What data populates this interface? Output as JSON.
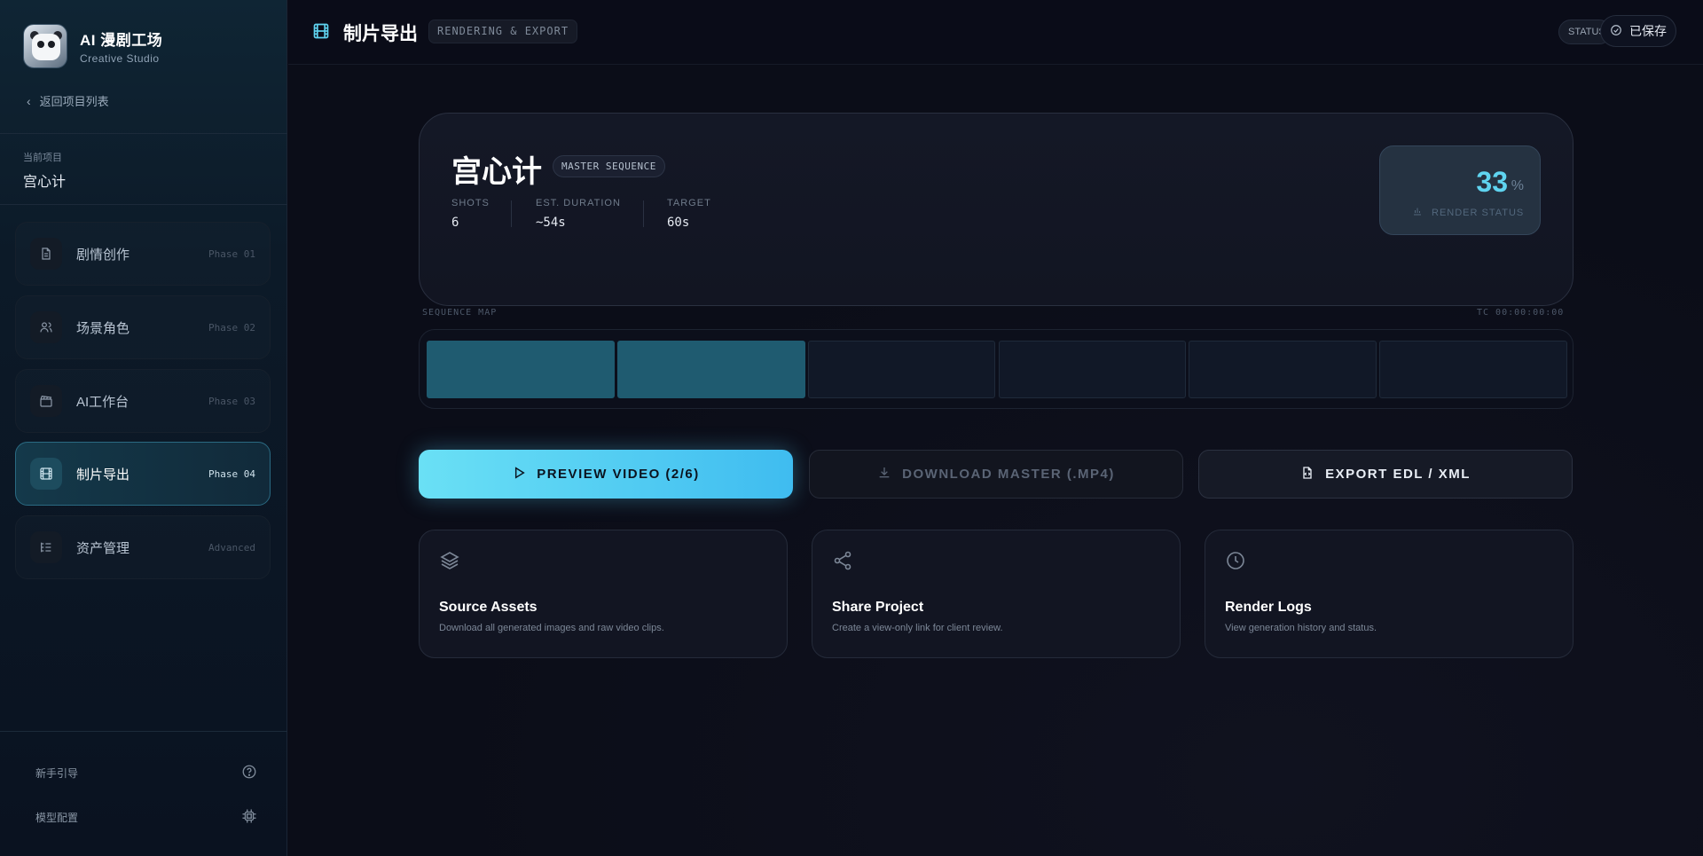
{
  "brand": {
    "title": "AI 漫剧工场",
    "subtitle": "Creative Studio"
  },
  "sidebar": {
    "back_label": "返回项目列表",
    "project_label": "当前项目",
    "project_name": "宫心计",
    "items": [
      {
        "label": "剧情创作",
        "phase": "Phase 01",
        "icon": "document-icon"
      },
      {
        "label": "场景角色",
        "phase": "Phase 02",
        "icon": "users-icon"
      },
      {
        "label": "AI工作台",
        "phase": "Phase 03",
        "icon": "clapperboard-icon"
      },
      {
        "label": "制片导出",
        "phase": "Phase 04",
        "icon": "film-icon",
        "active": true
      },
      {
        "label": "资产管理",
        "phase": "Advanced",
        "icon": "list-tree-icon"
      }
    ],
    "footer": [
      {
        "label": "新手引导",
        "icon": "help-circle-icon"
      },
      {
        "label": "模型配置",
        "icon": "cpu-icon"
      }
    ]
  },
  "header": {
    "title": "制片导出",
    "tag": "RENDERING & EXPORT",
    "status_label": "STATUS",
    "saved_label": "已保存"
  },
  "hero": {
    "title": "宫心计",
    "badge": "MASTER SEQUENCE",
    "stats": [
      {
        "key": "SHOTS",
        "value": "6"
      },
      {
        "key": "EST. DURATION",
        "value": "~54s"
      },
      {
        "key": "TARGET",
        "value": "60s"
      }
    ],
    "render": {
      "value": "33",
      "unit": "%",
      "label": "RENDER STATUS"
    }
  },
  "sequence": {
    "label": "SEQUENCE MAP",
    "timecode": "TC 00:00:00:00",
    "total_segments": 6,
    "completed_segments": 2
  },
  "actions": {
    "preview": "PREVIEW VIDEO (2/6)",
    "download": "DOWNLOAD MASTER (.MP4)",
    "export": "EXPORT EDL / XML"
  },
  "cards": [
    {
      "title": "Source Assets",
      "desc": "Download all generated images and raw video clips.",
      "icon": "layers-icon"
    },
    {
      "title": "Share Project",
      "desc": "Create a view-only link for client review.",
      "icon": "share-icon"
    },
    {
      "title": "Render Logs",
      "desc": "View generation history and status.",
      "icon": "clock-icon"
    }
  ],
  "colors": {
    "accent": "#5fd4f0",
    "active_border": "#2a6a82",
    "segment_done": "#1f5b70"
  }
}
